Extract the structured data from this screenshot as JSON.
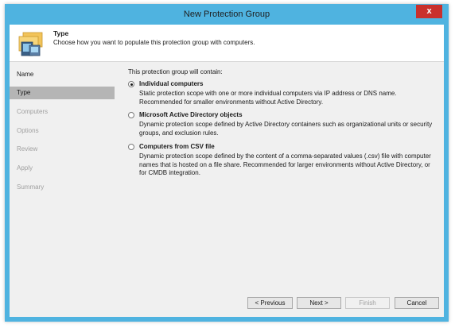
{
  "window": {
    "title": "New Protection Group",
    "close_label": "x"
  },
  "header": {
    "title": "Type",
    "subtitle": "Choose how you want to populate this protection group with computers."
  },
  "sidebar": {
    "items": [
      {
        "label": "Name",
        "state": "done"
      },
      {
        "label": "Type",
        "state": "active"
      },
      {
        "label": "Computers",
        "state": "pending"
      },
      {
        "label": "Options",
        "state": "pending"
      },
      {
        "label": "Review",
        "state": "pending"
      },
      {
        "label": "Apply",
        "state": "pending"
      },
      {
        "label": "Summary",
        "state": "pending"
      }
    ]
  },
  "main": {
    "lead": "This protection group will contain:",
    "options": [
      {
        "label": "Individual computers",
        "description": "Static protection scope with one or more individual computers via IP address or DNS name. Recommended for smaller environments without Active Directory.",
        "selected": true
      },
      {
        "label": "Microsoft Active Directory objects",
        "description": "Dynamic protection scope defined by Active Directory containers such as organizational units or security groups, and exclusion rules.",
        "selected": false
      },
      {
        "label": "Computers from CSV file",
        "description": "Dynamic protection scope defined by the content of a comma-separated values (.csv) file with computer names that is hosted on a file share. Recommended for larger environments without Active Directory, or for CMDB integration.",
        "selected": false
      }
    ]
  },
  "buttons": {
    "previous": "< Previous",
    "next": "Next >",
    "finish": "Finish",
    "cancel": "Cancel"
  },
  "colors": {
    "title_bar": "#4fb3e0",
    "close_button": "#c9302c",
    "active_nav": "#b5b5b5",
    "panel_background": "#f0f0f0"
  }
}
